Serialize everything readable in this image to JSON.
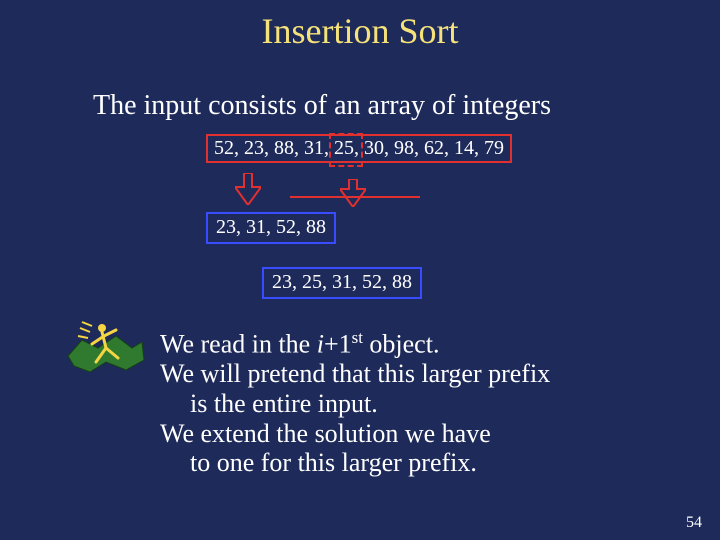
{
  "title": "Insertion Sort",
  "subtitle": "The input consists of an array of integers",
  "array_full": "52, 23, 88, 31, 25, 30, 98, 62, 14, 79",
  "sorted_prefix": "23, 31, 52, 88",
  "sorted_result": "23, 25, 31, 52, 88",
  "body": {
    "line1_prefix": "We read in the ",
    "line1_var": "i",
    "line1_plus": "+1",
    "line1_sup": "st",
    "line1_suffix": " object.",
    "line2": "We will pretend that this larger prefix",
    "line3": "is the entire input.",
    "line4": "We extend the solution we have",
    "line5": "to one for this larger prefix."
  },
  "page_number": "54",
  "colors": {
    "background": "#1d2a5a",
    "title": "#f6e27a",
    "red": "#e03030",
    "blue": "#3a4cff"
  }
}
